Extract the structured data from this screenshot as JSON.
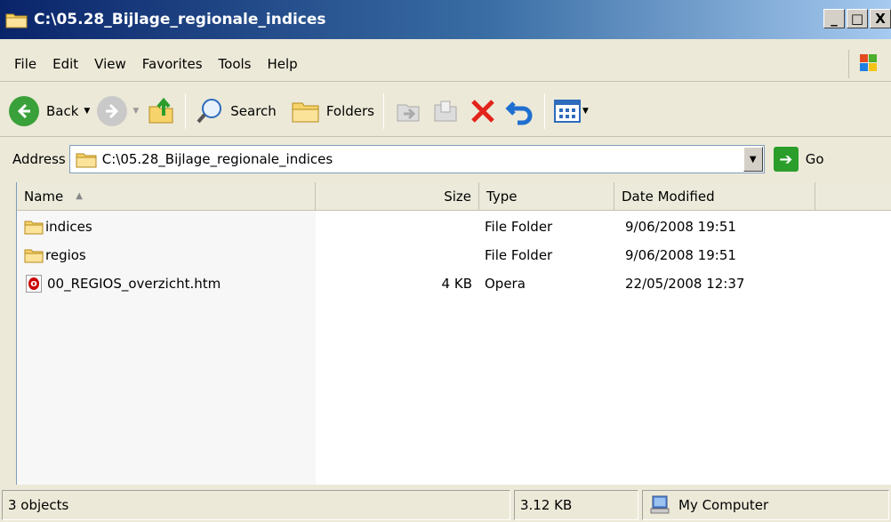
{
  "window": {
    "title": "C:\\05.28_Bijlage_regionale_indices",
    "minimize": "_",
    "maximize": "□",
    "close": "X"
  },
  "menu": [
    "File",
    "Edit",
    "View",
    "Favorites",
    "Tools",
    "Help"
  ],
  "toolbar": {
    "back_label": "Back",
    "search_label": "Search",
    "folders_label": "Folders"
  },
  "address": {
    "label": "Address",
    "value": "C:\\05.28_Bijlage_regionale_indices",
    "go_label": "Go"
  },
  "columns": {
    "name": "Name",
    "size": "Size",
    "type": "Type",
    "date": "Date Modified"
  },
  "files": [
    {
      "name": "indices",
      "size": "",
      "type": "File Folder",
      "date": "9/06/2008 19:51",
      "icon": "folder-icon"
    },
    {
      "name": "regios",
      "size": "",
      "type": "File Folder",
      "date": "9/06/2008 19:51",
      "icon": "folder-icon"
    },
    {
      "name": "00_REGIOS_overzicht.htm",
      "size": "4 KB",
      "type": "Opera",
      "date": "22/05/2008 12:37",
      "icon": "opera-document-icon"
    }
  ],
  "status": {
    "objects": "3 objects",
    "size": "3.12 KB",
    "location": "My Computer"
  }
}
